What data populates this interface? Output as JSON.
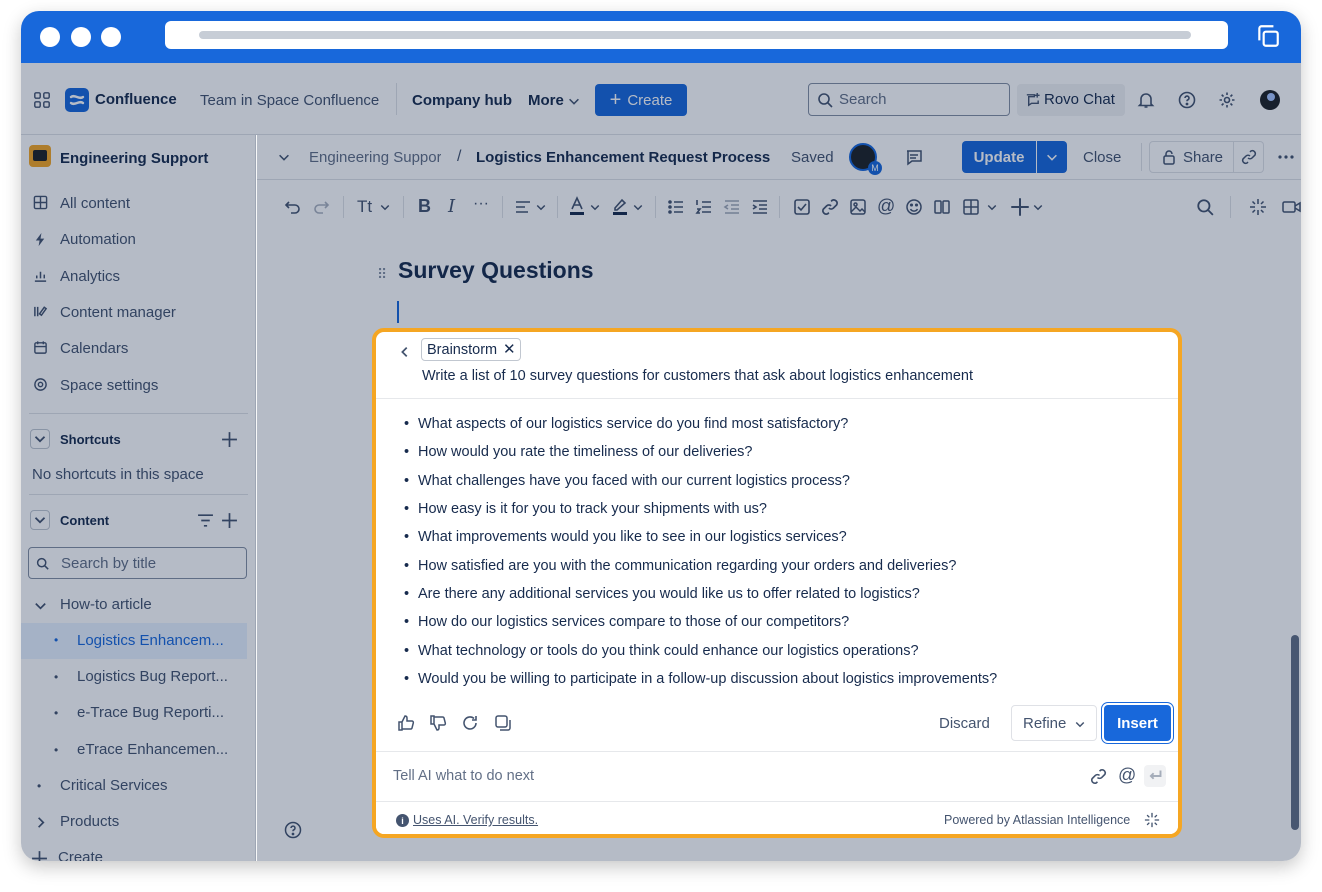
{
  "nav": {
    "app_name": "Confluence",
    "links": [
      "Team in Space Confluence",
      "Company hub",
      "More"
    ],
    "create_label": "Create",
    "search_placeholder": "Search",
    "rovo_label": "Rovo Chat"
  },
  "sidebar": {
    "space_name": "Engineering Support",
    "items": [
      "All content",
      "Automation",
      "Analytics",
      "Content manager",
      "Calendars",
      "Space settings"
    ],
    "shortcuts_title": "Shortcuts",
    "shortcuts_empty": "No shortcuts in this space",
    "content_title": "Content",
    "search_placeholder": "Search by title",
    "tree": {
      "folder": "How-to article",
      "children": [
        "Logistics Enhancem...",
        "Logistics Bug Report...",
        "e-Trace Bug Reporti...",
        "eTrace Enhancemen..."
      ],
      "others": [
        "Critical Services",
        "Products"
      ]
    },
    "create_label": "Create"
  },
  "header": {
    "breadcrumb": "Engineering Suppor",
    "title": "Logistics Enhancement Request Process",
    "saved": "Saved",
    "avatar_badge": "M",
    "update": "Update",
    "close": "Close",
    "share": "Share"
  },
  "toolbar": {
    "text_style": "Tt"
  },
  "editor": {
    "heading": "Survey Questions"
  },
  "ai_panel": {
    "chip": "Brainstorm",
    "prompt": "Write a list of 10 survey questions for customers that ask about logistics enhancement",
    "questions": [
      "What aspects of our logistics service do you find most satisfactory?",
      "How would you rate the timeliness of our deliveries?",
      "What challenges have you faced with our current logistics process?",
      "How easy is it for you to track your shipments with us?",
      "What improvements would you like to see in our logistics services?",
      "How satisfied are you with the communication regarding your orders and deliveries?",
      "Are there any additional services you would like us to offer related to logistics?",
      "How do our logistics services compare to those of our competitors?",
      "What technology or tools do you think could enhance our logistics operations?",
      "Would you be willing to participate in a follow-up discussion about logistics improvements?"
    ],
    "discard": "Discard",
    "refine": "Refine",
    "insert": "Insert",
    "input_placeholder": "Tell AI what to do next",
    "disclaimer": "Uses AI. Verify results.",
    "powered_by": "Powered by Atlassian Intelligence"
  }
}
